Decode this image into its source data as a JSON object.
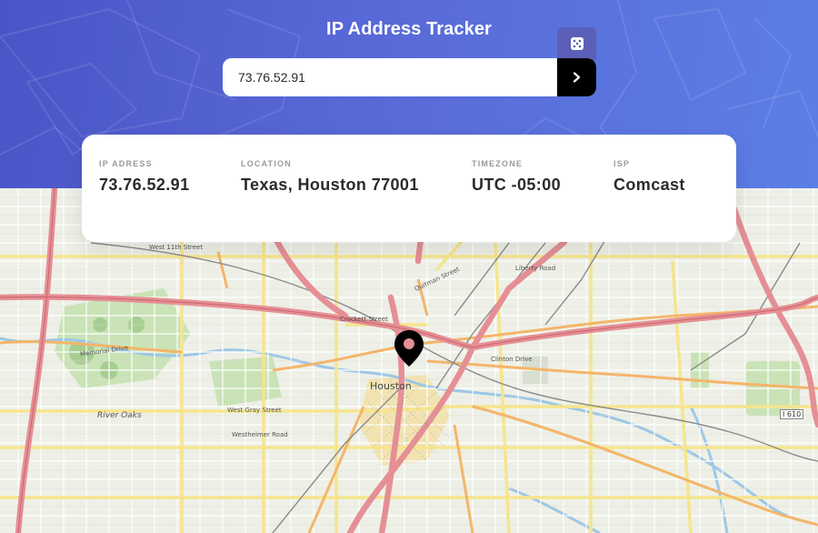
{
  "header": {
    "title": "IP Address Tracker",
    "dice_icon": "dice-icon",
    "accent": "#5b6fd8"
  },
  "search": {
    "value": "73.76.52.91",
    "submit_icon": "chevron-right-icon"
  },
  "info": [
    {
      "label": "IP ADRESS",
      "value": "73.76.52.91"
    },
    {
      "label": "LOCATION",
      "value": "Texas, Houston 77001"
    },
    {
      "label": "TIMEZONE",
      "value": "UTC -05:00"
    },
    {
      "label": "ISP",
      "value": "Comcast"
    }
  ],
  "map": {
    "city_label": "Houston",
    "marker_icon": "location-pin-icon",
    "labels": {
      "river_oaks": "River Oaks",
      "w11": "West 11th Street",
      "crockett": "Crockett Street",
      "memorial": "Memorial Drive",
      "westgray": "West Gray Street",
      "westheimer": "Westheimer Road",
      "clinton": "Clinton Drive",
      "liberty": "Liberty Road",
      "quitman": "Quitman Street",
      "i610": "I 610"
    }
  }
}
